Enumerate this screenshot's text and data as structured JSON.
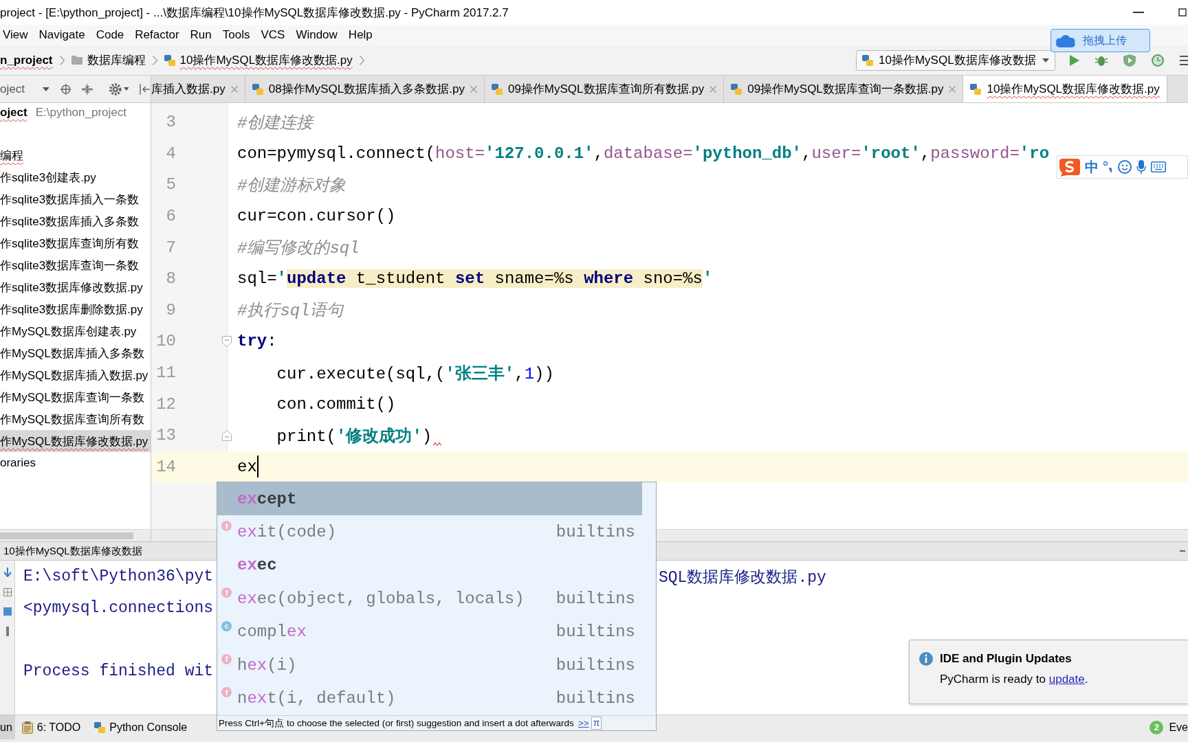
{
  "window": {
    "title": "project - [E:\\python_project] - ...\\数据库编程\\10操作MySQL数据库修改数据.py - PyCharm 2017.2.7"
  },
  "menu": [
    "View",
    "Navigate",
    "Code",
    "Refactor",
    "Run",
    "Tools",
    "VCS",
    "Window",
    "Help"
  ],
  "navigation_bar": {
    "crumbs": [
      {
        "kind": "project",
        "label": "n_project",
        "underlined": true
      },
      {
        "kind": "folder",
        "label": "数据库编程",
        "underlined": false
      },
      {
        "kind": "file",
        "label": "10操作MySQL数据库修改数据.py",
        "underlined": true
      }
    ],
    "run_configuration": "10操作MySQL数据库修改数据"
  },
  "upload_widget": {
    "label": "拖拽上传"
  },
  "project_panel": {
    "title": "oject",
    "root": {
      "label": "oject",
      "path": "E:\\python_project",
      "underlined": true
    },
    "items": [
      {
        "label": "编程",
        "selected": false,
        "underlined": true
      },
      {
        "label": "作sqlite3创建表.py",
        "selected": false,
        "underlined": false
      },
      {
        "label": "作sqlite3数据库插入一条数",
        "selected": false,
        "underlined": false
      },
      {
        "label": "作sqlite3数据库插入多条数",
        "selected": false,
        "underlined": false
      },
      {
        "label": "作sqlite3数据库查询所有数",
        "selected": false,
        "underlined": false
      },
      {
        "label": "作sqlite3数据库查询一条数",
        "selected": false,
        "underlined": false
      },
      {
        "label": "作sqlite3数据库修改数据.py",
        "selected": false,
        "underlined": false
      },
      {
        "label": "作sqlite3数据库删除数据.py",
        "selected": false,
        "underlined": false
      },
      {
        "label": "作MySQL数据库创建表.py",
        "selected": false,
        "underlined": false
      },
      {
        "label": "作MySQL数据库插入多条数",
        "selected": false,
        "underlined": false
      },
      {
        "label": "作MySQL数据库插入数据.py",
        "selected": false,
        "underlined": false
      },
      {
        "label": "作MySQL数据库查询一条数",
        "selected": false,
        "underlined": false
      },
      {
        "label": "作MySQL数据库查询所有数",
        "selected": false,
        "underlined": false
      },
      {
        "label": "作MySQL数据库修改数据.py",
        "selected": true,
        "underlined": true
      },
      {
        "label": "oraries",
        "selected": false,
        "underlined": false
      }
    ]
  },
  "editor_tabs": [
    {
      "label": "库插入数据.py",
      "selected": false,
      "file_icon": false,
      "close_button": true,
      "underlined": false
    },
    {
      "label": "08操作MySQL数据库插入多条数据.py",
      "selected": false,
      "file_icon": true,
      "close_button": true,
      "underlined": false
    },
    {
      "label": "09操作MySQL数据库查询所有数据.py",
      "selected": false,
      "file_icon": true,
      "close_button": true,
      "underlined": false
    },
    {
      "label": "09操作MySQL数据库查询一条数据.py",
      "selected": false,
      "file_icon": true,
      "close_button": true,
      "underlined": false
    },
    {
      "label": "10操作MySQL数据库修改数据.py",
      "selected": true,
      "file_icon": true,
      "close_button": false,
      "underlined": true
    }
  ],
  "editor": {
    "lines": [
      {
        "number": "3",
        "current": false,
        "squiggle": false,
        "tokens": [
          {
            "kind": "comment",
            "text": "#创建连接"
          }
        ]
      },
      {
        "number": "4",
        "current": false,
        "squiggle": false,
        "tokens": [
          {
            "kind": "plain",
            "text": "con=pymysql.connect("
          },
          {
            "kind": "param",
            "text": "host="
          },
          {
            "kind": "string",
            "text": "'127.0.0.1'"
          },
          {
            "kind": "plain",
            "text": ","
          },
          {
            "kind": "param",
            "text": "database="
          },
          {
            "kind": "string",
            "text": "'python_db'"
          },
          {
            "kind": "plain",
            "text": ","
          },
          {
            "kind": "param",
            "text": "user="
          },
          {
            "kind": "string",
            "text": "'root'"
          },
          {
            "kind": "plain",
            "text": ","
          },
          {
            "kind": "param",
            "text": "password="
          },
          {
            "kind": "string",
            "text": "'ro"
          }
        ]
      },
      {
        "number": "5",
        "current": false,
        "squiggle": false,
        "tokens": [
          {
            "kind": "comment",
            "text": "#创建游标对象"
          }
        ]
      },
      {
        "number": "6",
        "current": false,
        "squiggle": false,
        "tokens": [
          {
            "kind": "plain",
            "text": "cur=con.cursor()"
          }
        ]
      },
      {
        "number": "7",
        "current": false,
        "squiggle": false,
        "tokens": [
          {
            "kind": "comment",
            "text": "#编写修改的sql"
          }
        ]
      },
      {
        "number": "8",
        "current": false,
        "squiggle": false,
        "tokens": [
          {
            "kind": "plain",
            "text": "sql="
          },
          {
            "kind": "string",
            "text": "'"
          },
          {
            "kind": "sqlkw",
            "text": "update"
          },
          {
            "kind": "sql",
            "text": " t_student "
          },
          {
            "kind": "sqlkw",
            "text": "set"
          },
          {
            "kind": "sql",
            "text": " sname=%s "
          },
          {
            "kind": "sqlkw",
            "text": "where"
          },
          {
            "kind": "sql",
            "text": " sno=%s"
          },
          {
            "kind": "string",
            "text": "'"
          }
        ]
      },
      {
        "number": "9",
        "current": false,
        "squiggle": false,
        "tokens": [
          {
            "kind": "comment",
            "text": "#执行sql语句"
          }
        ]
      },
      {
        "number": "10",
        "fold_marker": {
          "kind": "start"
        },
        "current": false,
        "squiggle": false,
        "tokens": [
          {
            "kind": "keyword",
            "text": "try"
          },
          {
            "kind": "plain",
            "text": ":"
          }
        ]
      },
      {
        "number": "11",
        "current": false,
        "squiggle": false,
        "tokens": [
          {
            "kind": "plain",
            "text": "    cur.execute(sql,("
          },
          {
            "kind": "string",
            "text": "'张三丰'"
          },
          {
            "kind": "plain",
            "text": ","
          },
          {
            "kind": "number",
            "text": "1"
          },
          {
            "kind": "plain",
            "text": "))"
          }
        ]
      },
      {
        "number": "12",
        "current": false,
        "squiggle": false,
        "tokens": [
          {
            "kind": "plain",
            "text": "    con.commit()"
          }
        ]
      },
      {
        "number": "13",
        "fold_marker": {
          "kind": "end"
        },
        "current": false,
        "squiggle": true,
        "tokens": [
          {
            "kind": "plain",
            "text": "    print("
          },
          {
            "kind": "string",
            "text": "'修改成功'"
          },
          {
            "kind": "plain",
            "text": ")"
          }
        ]
      },
      {
        "number": "14",
        "current": true,
        "squiggle": false,
        "tokens": [
          {
            "kind": "plain",
            "text": "ex"
          }
        ]
      }
    ]
  },
  "completion_popup": {
    "items": [
      {
        "kind": "keyword",
        "selected": true,
        "parts": [
          {
            "text": "ex",
            "match": true
          },
          {
            "text": "cept",
            "match": false
          }
        ]
      },
      {
        "kind": "function",
        "icon": "f",
        "selected": false,
        "parts": [
          {
            "text": "ex",
            "match": true
          },
          {
            "text": "it(code)",
            "match": false
          }
        ],
        "source": "builtins"
      },
      {
        "kind": "keyword",
        "selected": false,
        "parts": [
          {
            "text": "ex",
            "match": true
          },
          {
            "text": "ec",
            "match": false
          }
        ]
      },
      {
        "kind": "function",
        "icon": "f",
        "selected": false,
        "parts": [
          {
            "text": "ex",
            "match": true
          },
          {
            "text": "ec(object, globals, locals)",
            "match": false
          }
        ],
        "source": "builtins"
      },
      {
        "kind": "class",
        "icon": "c",
        "selected": false,
        "parts": [
          {
            "text": "compl",
            "match": false
          },
          {
            "text": "ex",
            "match": true
          }
        ],
        "source": "builtins"
      },
      {
        "kind": "function",
        "icon": "f",
        "selected": false,
        "parts": [
          {
            "text": "h",
            "match": false
          },
          {
            "text": "ex",
            "match": true
          },
          {
            "text": "(i)",
            "match": false
          }
        ],
        "source": "builtins"
      },
      {
        "kind": "function",
        "icon": "f",
        "selected": false,
        "parts": [
          {
            "text": "n",
            "match": false
          },
          {
            "text": "ex",
            "match": true
          },
          {
            "text": "t(i, default)",
            "match": false
          }
        ],
        "source": "builtins"
      }
    ],
    "hint": "Press Ctrl+句点 to choose the selected (or first) suggestion and insert a dot afterwards",
    "hint_link": ">>",
    "pin": "π"
  },
  "input_method_bar": {
    "mode": "中"
  },
  "run_panel": {
    "title": "10操作MySQL数据库修改数据",
    "lines": [
      {
        "kind": "text",
        "left": "E:\\soft\\Python36\\pyt",
        "right": "SQL数据库修改数据.py"
      },
      {
        "kind": "text",
        "left": "<pymysql.connections"
      },
      {
        "kind": "blank"
      },
      {
        "kind": "text",
        "left": "Process finished wit"
      }
    ]
  },
  "tool_windows": [
    {
      "kind": "run",
      "label": "un",
      "selected": true
    },
    {
      "kind": "todo",
      "label": "6: TODO",
      "selected": false
    },
    {
      "kind": "console",
      "label": "Python Console",
      "selected": false
    }
  ],
  "event_log": {
    "count": "2",
    "label": "Eve"
  },
  "notification": {
    "title": "IDE and Plugin Updates",
    "text": "PyCharm is ready to ",
    "link": "update",
    "after": "."
  }
}
